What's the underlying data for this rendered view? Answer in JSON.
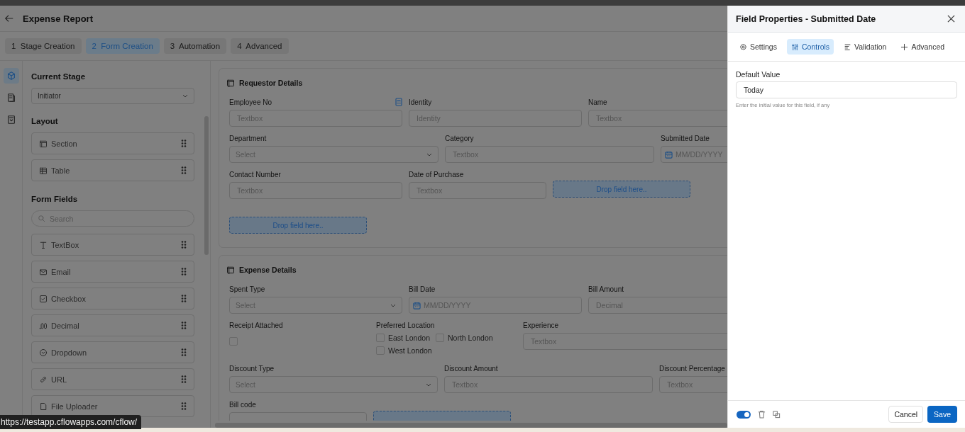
{
  "window": {
    "title": "Expense Report"
  },
  "steps": [
    {
      "number": "1",
      "label": "Stage Creation",
      "selected": false
    },
    {
      "number": "2",
      "label": "Form Creation",
      "selected": true
    },
    {
      "number": "3",
      "label": "Automation",
      "selected": false
    },
    {
      "number": "4",
      "label": "Advanced",
      "selected": false
    }
  ],
  "rail": [
    {
      "kind": "cube",
      "selected": true
    },
    {
      "kind": "book",
      "selected": false
    },
    {
      "kind": "form",
      "selected": false
    }
  ],
  "sidebar": {
    "current_stage": {
      "heading": "Current Stage",
      "value": "Initiator"
    },
    "layout": {
      "heading": "Layout",
      "items": [
        {
          "kind": "section",
          "label": "Section"
        },
        {
          "kind": "table",
          "label": "Table"
        }
      ]
    },
    "form_fields": {
      "heading": "Form Fields",
      "search_placeholder": "Search",
      "items": [
        {
          "kind": "text",
          "label": "TextBox"
        },
        {
          "kind": "email",
          "label": "Email"
        },
        {
          "kind": "checkbox",
          "label": "Checkbox"
        },
        {
          "kind": "decimal",
          "label": "Decimal"
        },
        {
          "kind": "dropdown",
          "label": "Dropdown"
        },
        {
          "kind": "url",
          "label": "URL"
        },
        {
          "kind": "file",
          "label": "File Uploader"
        }
      ]
    }
  },
  "sections": [
    {
      "title": "Requestor Details",
      "rows": [
        [
          {
            "kind": "textbox",
            "label": "Employee No",
            "placeholder": "Textbox",
            "formula": true
          },
          {
            "kind": "textbox",
            "label": "Identity",
            "placeholder": "Identity",
            "formula": false
          },
          {
            "kind": "textbox",
            "label": "Name",
            "placeholder": "Textbox",
            "formula": false
          }
        ],
        [
          {
            "kind": "dropdown",
            "label": "Department",
            "placeholder": "Select"
          },
          {
            "kind": "textbox",
            "label": "Category",
            "placeholder": "Textbox",
            "formula": false
          },
          {
            "kind": "date",
            "label": "Submitted Date",
            "placeholder": "MM/DD/YYYY"
          }
        ],
        [
          {
            "kind": "textbox",
            "label": "Contact Number",
            "placeholder": "Textbox",
            "formula": false
          },
          {
            "kind": "textbox",
            "label": "Date of Purchase",
            "placeholder": "Textbox",
            "formula": false
          },
          {
            "kind": "dropzone",
            "text": "Drop field here.."
          }
        ],
        [
          {
            "kind": "dropzone",
            "text": "Drop field here.."
          }
        ]
      ]
    },
    {
      "title": "Expense Details",
      "rows": [
        [
          {
            "kind": "dropdown",
            "label": "Spent Type",
            "placeholder": "Select"
          },
          {
            "kind": "date",
            "label": "Bill Date",
            "placeholder": "MM/DD/YYYY"
          },
          {
            "kind": "textbox",
            "label": "Bill Amount",
            "placeholder": "Decimal",
            "formula": false
          }
        ],
        [
          {
            "kind": "checkbox",
            "label": "Receipt Attached",
            "checked": false
          },
          {
            "kind": "checkgroup",
            "label": "Preferred Location",
            "options": [
              {
                "label": "East London",
                "checked": false
              },
              {
                "label": "North London",
                "checked": false
              },
              {
                "label": "West London",
                "checked": false
              }
            ]
          },
          {
            "kind": "textbox",
            "label": "Experience",
            "placeholder": "Textbox",
            "formula": false
          }
        ],
        [
          {
            "kind": "dropdown",
            "label": "Discount Type",
            "placeholder": "Select"
          },
          {
            "kind": "textbox",
            "label": "Discount Amount",
            "placeholder": "Textbox",
            "formula": false
          },
          {
            "kind": "textbox",
            "label": "Discount Percentage",
            "placeholder": "Textbox",
            "formula": false
          }
        ],
        [
          {
            "kind": "textbox",
            "label": "Bill code",
            "formula": false
          },
          {
            "kind": "dropzone"
          }
        ]
      ]
    }
  ],
  "drawer": {
    "title": "Field Properties - Submitted Date",
    "tabs": [
      {
        "kind": "settings",
        "label": "Settings",
        "selected": false
      },
      {
        "kind": "controls",
        "label": "Controls",
        "selected": true
      },
      {
        "kind": "validation",
        "label": "Validation",
        "selected": false
      },
      {
        "kind": "advanced",
        "label": "Advanced",
        "selected": false
      }
    ],
    "default_value": {
      "label": "Default Value",
      "value": "Today",
      "help": "Enter the initial value for this field, if any"
    },
    "footer": {
      "enabled": true,
      "cancel": "Cancel",
      "save": "Save"
    }
  },
  "status_url": "https://testapp.cflowapps.com/cflow/"
}
